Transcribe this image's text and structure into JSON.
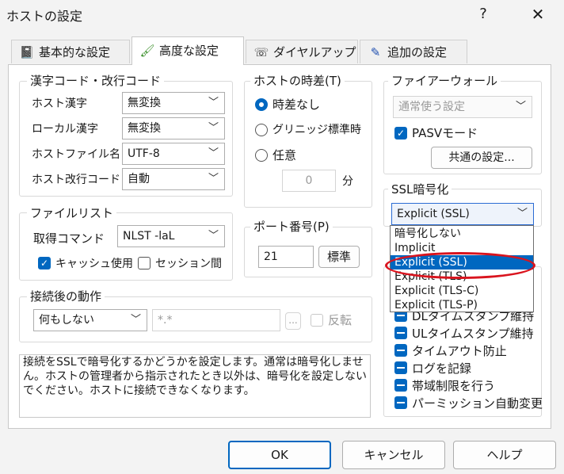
{
  "window": {
    "title": "ホストの設定",
    "help_label": "?",
    "close_label": "✕"
  },
  "tabs": [
    {
      "icon": "notebook-icon",
      "glyph": "📓",
      "label": "基本的な設定",
      "active": false
    },
    {
      "icon": "brush-icon",
      "glyph": "🖌",
      "label": "高度な設定",
      "active": true
    },
    {
      "icon": "phone-icon",
      "glyph": "☏",
      "label": "ダイヤルアップ",
      "active": false
    },
    {
      "icon": "pen-icon",
      "glyph": "✎",
      "label": "追加の設定",
      "active": false
    }
  ],
  "kanji_group": {
    "legend": "漢字コード・改行コード",
    "rows": [
      {
        "label": "ホスト漢字",
        "value": "無変換"
      },
      {
        "label": "ローカル漢字",
        "value": "無変換"
      },
      {
        "label": "ホストファイル名",
        "value": "UTF-8"
      },
      {
        "label": "ホスト改行コード",
        "value": "自動"
      }
    ]
  },
  "timezone_group": {
    "legend": "ホストの時差(T)",
    "options": [
      {
        "label": "時差なし",
        "selected": true
      },
      {
        "label": "グリニッジ標準時",
        "selected": false
      },
      {
        "label": "任意",
        "selected": false
      }
    ],
    "offset_value": "0",
    "offset_unit": "分"
  },
  "firewall_group": {
    "legend": "ファイアーウォール",
    "mode_value": "通常使う設定",
    "pasv_label": "PASVモード",
    "pasv_checked": true,
    "common_button": "共通の設定..."
  },
  "filelist_group": {
    "legend": "ファイルリスト",
    "command_label": "取得コマンド",
    "command_value": "NLST -laL",
    "cache_label": "キャッシュ使用",
    "cache_checked": true,
    "session_label": "セッション間",
    "session_checked": false
  },
  "port_group": {
    "legend": "ポート番号(P)",
    "value": "21",
    "default_button": "標準"
  },
  "ssl_group": {
    "legend": "SSL暗号化",
    "selected": "Explicit (SSL)",
    "options": [
      "暗号化しない",
      "Implicit",
      "Explicit (SSL)",
      "Explicit (TLS)",
      "Explicit (TLS-C)",
      "Explicit (TLS-P)"
    ],
    "selected_index": 2
  },
  "after_connect_group": {
    "legend": "接続後の動作",
    "action_value": "何もしない",
    "pattern_value": "*.*",
    "browse_label": "...",
    "reverse_label": "反転"
  },
  "extra_options": [
    {
      "label": "DLタイムスタンプ維持"
    },
    {
      "label": "ULタイムスタンプ維持"
    },
    {
      "label": "タイムアウト防止"
    },
    {
      "label": "ログを記録"
    },
    {
      "label": "帯域制限を行う"
    },
    {
      "label": "パーミッション自動変更"
    }
  ],
  "description": "接続をSSLで暗号化するかどうかを設定します。通常は暗号化しません。ホストの管理者から指示されたとき以外は、暗号化を設定しないでください。ホストに接続できなくなります。",
  "buttons": {
    "ok": "OK",
    "cancel": "キャンセル",
    "help": "ヘルプ"
  },
  "colors": {
    "accent": "#0067c0",
    "highlight_ring": "#d9141e"
  }
}
